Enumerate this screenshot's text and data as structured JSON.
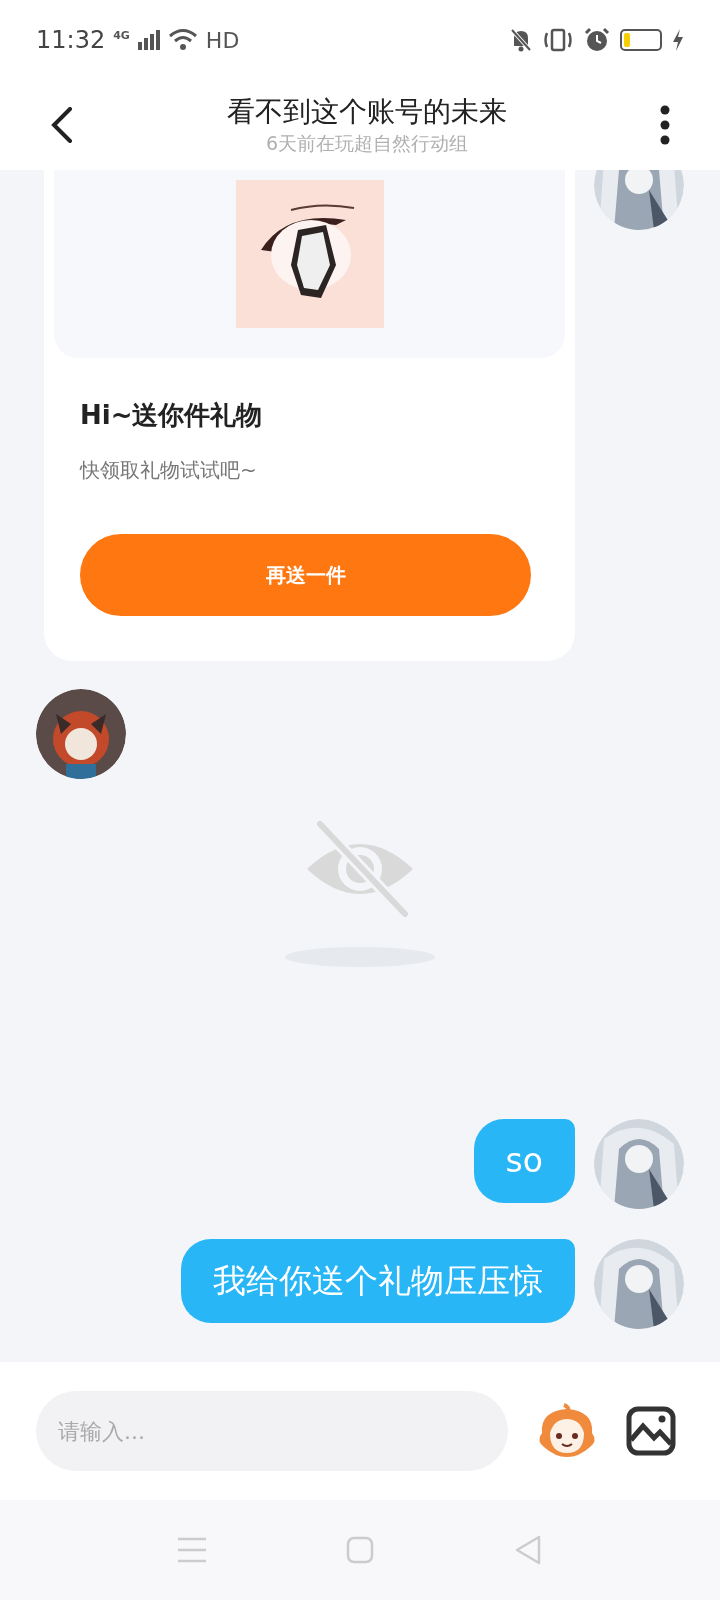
{
  "status_bar": {
    "time": "11:32",
    "network": "4G",
    "wifi_label": "HD"
  },
  "header": {
    "title": "看不到这个账号的未来",
    "subtitle": "6天前在玩超自然行动组"
  },
  "messages": [
    {
      "kind": "gift_card",
      "outgoing": true,
      "title": "Hi~送你件礼物",
      "subtitle": "快领取礼物试试吧~",
      "button": "再送一件"
    },
    {
      "kind": "image_unavailable",
      "outgoing": false
    },
    {
      "kind": "text",
      "outgoing": true,
      "text": "so"
    },
    {
      "kind": "text",
      "outgoing": true,
      "text": "我给你送个礼物压压惊"
    }
  ],
  "composer": {
    "placeholder": "请输入..."
  }
}
